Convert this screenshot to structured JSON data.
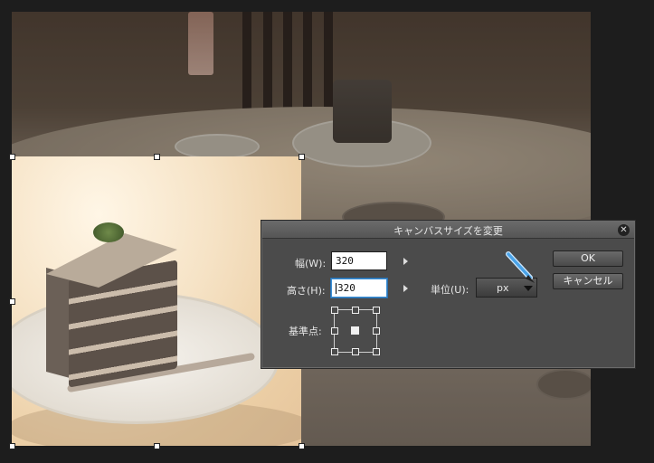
{
  "dialog": {
    "title": "キャンバスサイズを変更",
    "close_glyph": "✕",
    "width_label": "幅(W):",
    "width_value": "320",
    "height_label": "高さ(H):",
    "height_value": "320",
    "unit_label": "単位(U):",
    "unit_value": "px",
    "anchor_label": "基準点:",
    "anchor_selected": "center",
    "ok_label": "OK",
    "cancel_label": "キャンセル"
  },
  "icons": [
    "close-icon",
    "arrow-right-icon",
    "pen-icon",
    "chevron-down-icon"
  ],
  "colors": {
    "dialog_bg": "#4b4b4b",
    "active_field_border": "#3b8fd6"
  }
}
